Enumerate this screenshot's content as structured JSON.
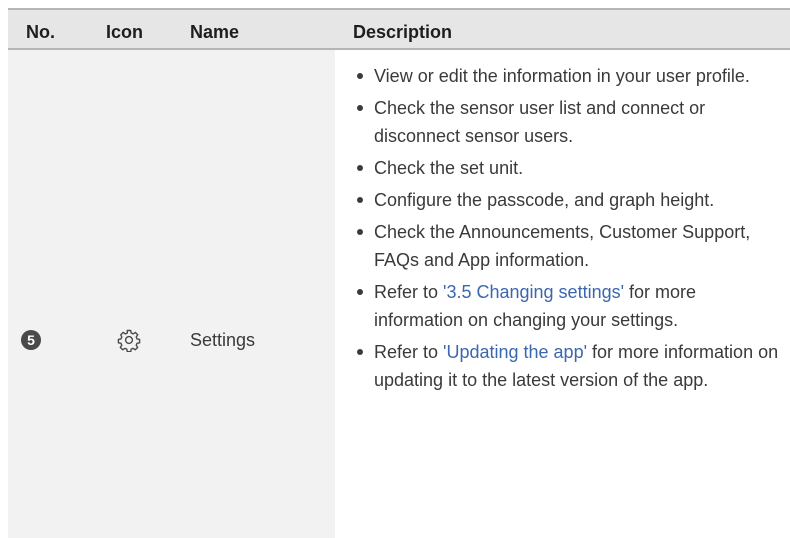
{
  "table": {
    "headers": {
      "no": "No.",
      "icon": "Icon",
      "name": "Name",
      "description": "Description"
    },
    "row": {
      "number": "5",
      "icon": "gear-icon",
      "name": "Settings",
      "bullets": [
        {
          "text": "View or edit the information in your user profile."
        },
        {
          "text": "Check the sensor user list and connect or disconnect sensor users."
        },
        {
          "text": "Check the set unit."
        },
        {
          "text": "Configure the passcode, and graph height."
        },
        {
          "text": "Check the Announcements, Customer Support, FAQs and App information."
        },
        {
          "prefix": "Refer to ",
          "link": "'3.5 Changing settings'",
          "suffix": " for more information on changing your settings."
        },
        {
          "prefix": "Refer to ",
          "link": "'Updating the app'",
          "suffix": " for more information on updating it to the latest version of the app."
        }
      ]
    }
  },
  "colors": {
    "header_bg": "#e6e6e6",
    "left_cell_bg": "#f2f2f2",
    "link": "#3b67b0",
    "text": "#3a3a3a"
  }
}
